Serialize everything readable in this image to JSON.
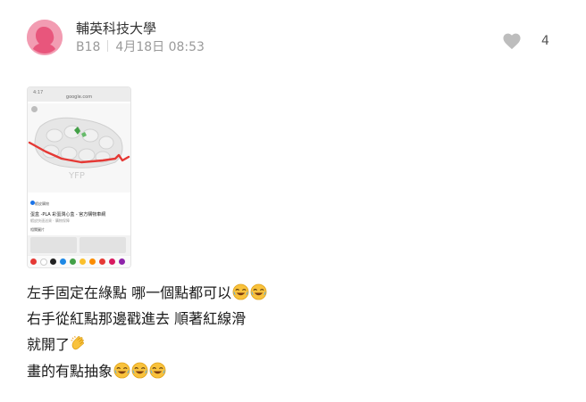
{
  "post": {
    "author": "輔英科技大學",
    "floor": "B18",
    "date": "4月18日 08:53",
    "like_count": "4"
  },
  "screenshot": {
    "status_time": "4:17",
    "url": "google.com",
    "source": "蝦皮購物",
    "title": "蛋盒 -PLA 彩蛋潤心盒 - 官方購物車網",
    "subtitle": "蝦皮快速送貨 · 購物保障",
    "related": "相關圖片",
    "watermark": "YFP"
  },
  "body_lines": [
    "左手固定在綠點 哪一個點都可以",
    "右手從紅點那邊戳進去 順著紅線滑",
    "就開了",
    "畫的有點抽象"
  ],
  "colors": {
    "avatar_bg": "#f29cb2",
    "avatar_fg": "#e8567c",
    "like_icon": "#bdbdbd",
    "drawn_line": "#e53935",
    "drawn_dot": "#43a047"
  },
  "icons": {
    "like": "heart-icon",
    "laugh": "face-with-tears-of-joy-icon",
    "clap": "clapping-hands-icon"
  }
}
